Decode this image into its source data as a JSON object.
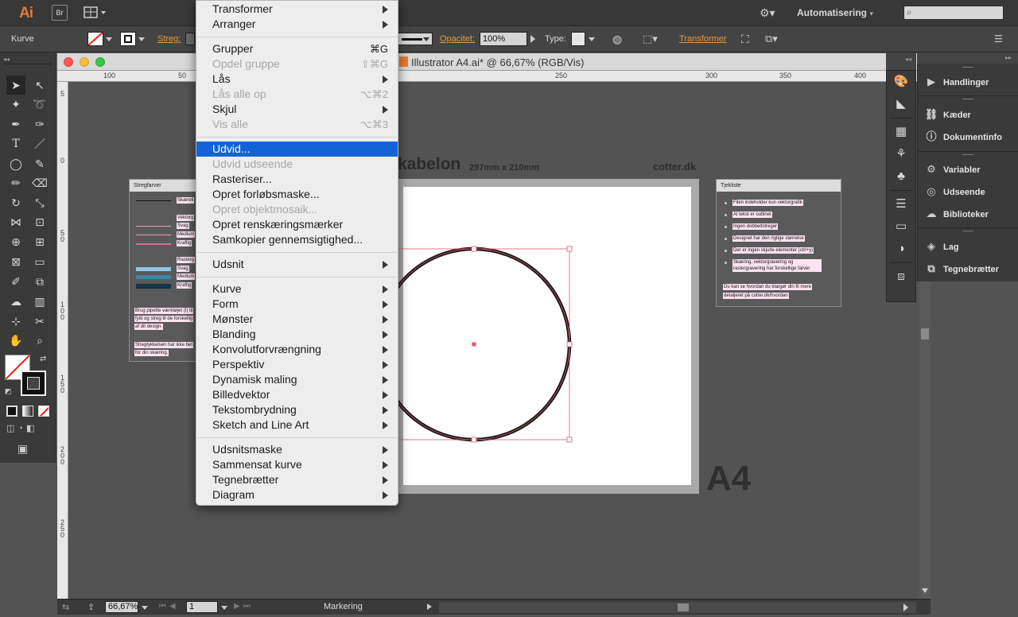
{
  "app": {
    "logo": "Ai",
    "bridge_label": "Br",
    "workspace": "Automatisering"
  },
  "controlbar": {
    "object_type": "Kurve",
    "stroke_label": "Streg:",
    "opacity_label": "Opacitet:",
    "opacity_value": "100%",
    "type_label": "Type:",
    "transform_label": "Transformer"
  },
  "document": {
    "title": "Illustrator A4.ai* @ 66,67% (RGB/Vis)",
    "ruler_h": [
      "100",
      "50",
      "250",
      "300",
      "350",
      "400"
    ],
    "ruler_v": [
      "5",
      "0",
      "5 0",
      "1 0 0",
      "1 5 0",
      "2 0 0",
      "2 5 0"
    ],
    "artboard_title": "kabelon",
    "artboard_size": "297mm x 210mm",
    "artboard_brand": "cotter.dk",
    "a4_label": "A4"
  },
  "left_card": {
    "title": "Stregfarver",
    "labels": [
      "Skæreli",
      "Vektorg",
      "Svag",
      "Medium",
      "Kraftig",
      "Rasterg",
      "Svag",
      "Medium",
      "Kraftig"
    ],
    "note1": [
      "Brug pipette værktøjet (I) til",
      "fyld og streg til de forskellig",
      "af dit design."
    ],
    "note2": [
      "Stregtykkelsen har ikke bet",
      "for din skæring."
    ]
  },
  "right_card": {
    "title": "Tjekliste",
    "items": [
      "Filen indeholder kun vektorgrafik",
      "Al tekst er outlinet",
      "Ingen dobbeltstreger",
      "Designet har den rigtige størrelse",
      "Der er ingen skjulte elementer (ctrl+y)",
      "Skæring, vektorgravering og rastergravering har forskellige farver"
    ],
    "footer": [
      "Du kan se hvordan du klargør din fil mere",
      "detaljeret på cotter.dk/hvordan"
    ]
  },
  "menu": {
    "items": [
      {
        "label": "Transformer",
        "shortcut": "",
        "disabled": false,
        "submenu": true
      },
      {
        "label": "Arranger",
        "shortcut": "",
        "disabled": false,
        "submenu": true
      },
      {
        "label": "Grupper",
        "shortcut": "⌘G",
        "disabled": false,
        "submenu": false
      },
      {
        "label": "Opdel gruppe",
        "shortcut": "⇧⌘G",
        "disabled": true,
        "submenu": false
      },
      {
        "label": "Lås",
        "shortcut": "",
        "disabled": false,
        "submenu": true
      },
      {
        "label": "Lås alle op",
        "shortcut": "⌥⌘2",
        "disabled": true,
        "submenu": false
      },
      {
        "label": "Skjul",
        "shortcut": "",
        "disabled": false,
        "submenu": true
      },
      {
        "label": "Vis alle",
        "shortcut": "⌥⌘3",
        "disabled": true,
        "submenu": false
      },
      {
        "label": "Udvid...",
        "shortcut": "",
        "disabled": false,
        "submenu": false,
        "selected": true
      },
      {
        "label": "Udvid udseende",
        "shortcut": "",
        "disabled": true,
        "submenu": false
      },
      {
        "label": "Rasteriser...",
        "shortcut": "",
        "disabled": false,
        "submenu": false
      },
      {
        "label": "Opret forløbsmaske...",
        "shortcut": "",
        "disabled": false,
        "submenu": false
      },
      {
        "label": "Opret objektmosaik...",
        "shortcut": "",
        "disabled": true,
        "submenu": false
      },
      {
        "label": "Opret renskæringsmærker",
        "shortcut": "",
        "disabled": false,
        "submenu": false
      },
      {
        "label": "Samkopier gennemsigtighed...",
        "shortcut": "",
        "disabled": false,
        "submenu": false
      },
      {
        "label": "Udsnit",
        "shortcut": "",
        "disabled": false,
        "submenu": true
      },
      {
        "label": "Kurve",
        "shortcut": "",
        "disabled": false,
        "submenu": true
      },
      {
        "label": "Form",
        "shortcut": "",
        "disabled": false,
        "submenu": true
      },
      {
        "label": "Mønster",
        "shortcut": "",
        "disabled": false,
        "submenu": true
      },
      {
        "label": "Blanding",
        "shortcut": "",
        "disabled": false,
        "submenu": true
      },
      {
        "label": "Konvolutforvrængning",
        "shortcut": "",
        "disabled": false,
        "submenu": true
      },
      {
        "label": "Perspektiv",
        "shortcut": "",
        "disabled": false,
        "submenu": true
      },
      {
        "label": "Dynamisk maling",
        "shortcut": "",
        "disabled": false,
        "submenu": true
      },
      {
        "label": "Billedvektor",
        "shortcut": "",
        "disabled": false,
        "submenu": true
      },
      {
        "label": "Tekstombrydning",
        "shortcut": "",
        "disabled": false,
        "submenu": true
      },
      {
        "label": "Sketch and Line Art",
        "shortcut": "",
        "disabled": false,
        "submenu": true
      },
      {
        "label": "Udsnitsmaske",
        "shortcut": "",
        "disabled": false,
        "submenu": true
      },
      {
        "label": "Sammensat kurve",
        "shortcut": "",
        "disabled": false,
        "submenu": true
      },
      {
        "label": "Tegnebrætter",
        "shortcut": "",
        "disabled": false,
        "submenu": true
      },
      {
        "label": "Diagram",
        "shortcut": "",
        "disabled": false,
        "submenu": true
      }
    ]
  },
  "panels": {
    "items": [
      "Handlinger",
      "Kæder",
      "Dokumentinfo",
      "Variabler",
      "Udseende",
      "Biblioteker",
      "Lag",
      "Tegnebrætter"
    ]
  },
  "statusbar": {
    "zoom": "66,67%",
    "artboard": "1",
    "mode": "Markering"
  },
  "colors": {
    "selection": "#1264d6",
    "bounding_box": "#e05a6a",
    "accent_orange": "#e09a4a"
  }
}
